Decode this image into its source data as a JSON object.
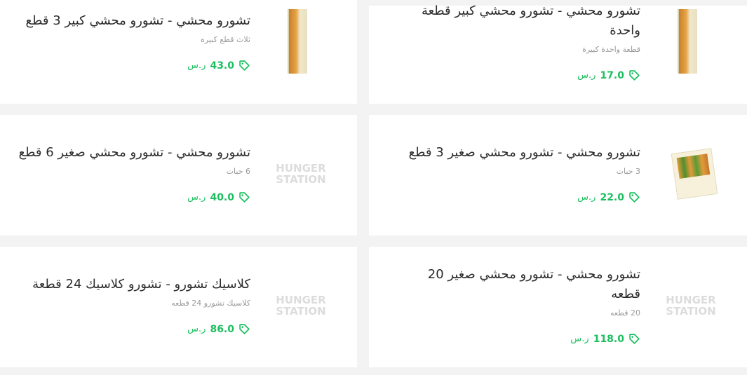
{
  "currency_label": "ر.س",
  "placeholder_brand": "HUNGER STATION",
  "colors": {
    "price": "#1bbf5f",
    "title": "#2b2b2b",
    "subtitle": "#9a9a9a",
    "background": "#f3f3f3"
  },
  "items": [
    {
      "title": "تشورو محشي - تشورو محشي كبير قطعة واحدة",
      "subtitle": "قطعة واحدة كبيرة",
      "price": "17.0",
      "image": "stick"
    },
    {
      "title": "تشورو محشي - تشورو محشي كبير 3 قطع",
      "subtitle": "ثلاث قطع كبيره",
      "price": "43.0",
      "image": "stick"
    },
    {
      "title": "تشورو محشي - تشورو محشي صغير 3 قطع",
      "subtitle": "3 حبات",
      "price": "22.0",
      "image": "box"
    },
    {
      "title": "تشورو محشي - تشورو محشي صغير 6 قطع",
      "subtitle": "6 حبات",
      "price": "40.0",
      "image": "placeholder"
    },
    {
      "title": "تشورو محشي - تشورو محشي صغير 20 قطعه",
      "subtitle": "20 قطعه",
      "price": "118.0",
      "image": "placeholder"
    },
    {
      "title": "كلاسيك تشورو - تشورو كلاسيك 24 قطعة",
      "subtitle": "كلاسيك تشورو 24 قطعه",
      "price": "86.0",
      "image": "placeholder"
    }
  ]
}
